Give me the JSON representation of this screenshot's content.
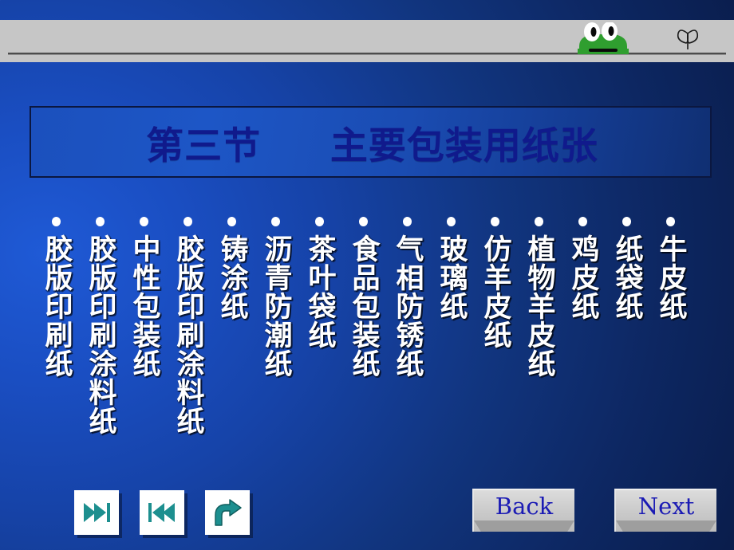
{
  "slide": {
    "title": "第三节     主要包装用纸张",
    "background_color_left": "#1f5ad6",
    "background_color_right": "#081740",
    "title_text_color": "#101a8c",
    "list_text_color": "#ffffff"
  },
  "banner": {
    "icons": [
      {
        "name": "frog-graphic",
        "label": "frog"
      },
      {
        "name": "butterfly-glyph",
        "label": "butterfly"
      }
    ],
    "background_color": "#c6c6c6"
  },
  "list": {
    "items": [
      {
        "text": "牛皮纸"
      },
      {
        "text": "纸袋纸"
      },
      {
        "text": "鸡皮纸"
      },
      {
        "text": "植物羊皮纸"
      },
      {
        "text": "仿羊皮纸"
      },
      {
        "text": "玻璃纸"
      },
      {
        "text": "气相防锈纸"
      },
      {
        "text": "食品包装纸"
      },
      {
        "text": "茶叶袋纸"
      },
      {
        "text": "沥青防潮纸"
      },
      {
        "text": "铸涂纸"
      },
      {
        "text": "胶版印刷涂料纸"
      },
      {
        "text": "中性包装纸"
      },
      {
        "text": "胶版印刷涂料纸"
      },
      {
        "text": "胶版印刷纸"
      }
    ]
  },
  "nav": {
    "fast_forward_icon": "skip-forward-icon",
    "rewind_icon": "skip-backward-icon",
    "return_icon": "curved-arrow-icon",
    "icon_color": "#1d8f8f",
    "back_label": "Back",
    "next_label": "Next",
    "button_text_color": "#1b1bb4"
  }
}
